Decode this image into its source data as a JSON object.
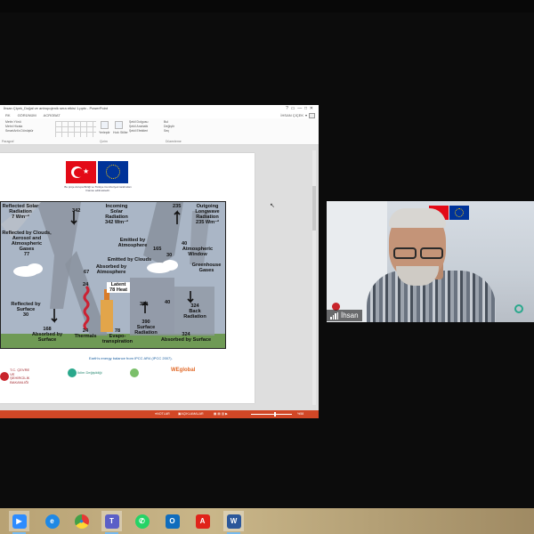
{
  "powerpoint": {
    "doc_title": "İhsan Çiçek_Doğal ve antropojenik sera etkisi 1.pptx - PowerPoint",
    "tabs": [
      "RK",
      "GÖRÜNÜM",
      "ACROBAT"
    ],
    "user_name": "İhsan Çiçek",
    "ribbon": {
      "slide_items": [
        "Metin Yönü",
        "Metni Hizala",
        "SmartArt'a Dönüştür"
      ],
      "arrange_label": "Yerleştir",
      "quick_styles_label": "Hızlı Stiller",
      "shape_fill": "Şekil Dolgusu",
      "shape_outline": "Şekil Anahattı",
      "shape_effects": "Şekil Efektleri",
      "find": "Bul",
      "replace": "Değiştir",
      "select": "Seç",
      "group_paragraph": "Paragraf",
      "group_drawing": "Çizim",
      "group_editing": "Düzenleme"
    },
    "slide": {
      "eu_note": "Bu proje Avrupa Birliği ve Türkiye Cumhuriyeti tarafından finanse edilmektedir.",
      "diagram_labels": {
        "reflected_solar": "Reflected Solar\nRadiation\n7 Wm⁻²",
        "incoming_342": "342",
        "incoming_solar": "Incoming\nSolar\nRadiation\n342 Wm⁻²",
        "outgoing_235": "235",
        "outgoing_longwave": "Outgoing\nLongwave\nRadiation\n235 Wm⁻²",
        "reflected_clouds": "Reflected by Clouds,\nAerosol and\nAtmospheric\nGases\n77",
        "emitted_atmosphere": "Emitted by\nAtmosphere",
        "val_165": "165",
        "val_30": "30",
        "val_40_window": "40",
        "atmospheric_window": "Atmospheric\nWindow",
        "emitted_clouds": "Emitted by Clouds",
        "greenhouse_gases": "Greenhouse\nGases",
        "val_67": "67",
        "absorbed_atmosphere": "Absorbed by\nAtmosphere",
        "latent_heat": "Latent\n78 Heat",
        "val_24": "24",
        "val_350": "350",
        "val_40": "40",
        "val_324_back": "324\nBack\nRadiation",
        "reflected_surface": "Reflected by\nSurface\n30",
        "absorbed_surface_168": "168\nAbsorbed by\nSurface",
        "thermals": "24\nThermals",
        "evapotranspiration": "78\nEvapo-\ntranspiration",
        "surface_radiation": "390\nSurface\nRadiation",
        "absorbed_surface_324": "324\nAbsorbed by Surface"
      },
      "caption": "Earth's energy balance from IPCC AR4 (IPCC 2007).",
      "partners": [
        "T.C. ÇEVRE VE ŞEHİRCİLİK BAKANLIĞI",
        "İklim Değişikliği",
        "WEglobal"
      ]
    },
    "statusbar": {
      "notes": "NOTLAR",
      "comments": "AÇIKLAMALAR",
      "zoom": "%58"
    }
  },
  "video": {
    "participant_name": "İhsan"
  },
  "taskbar": {
    "apps": [
      {
        "name": "zoom",
        "glyph": "▶",
        "color": "#2d8cff"
      },
      {
        "name": "internet-explorer",
        "glyph": "e",
        "color": "#1e88e5"
      },
      {
        "name": "chrome",
        "glyph": "●",
        "color": "#e53935"
      },
      {
        "name": "teams",
        "glyph": "T",
        "color": "#5b5fc7"
      },
      {
        "name": "whatsapp",
        "glyph": "✆",
        "color": "#25d366"
      },
      {
        "name": "outlook",
        "glyph": "O",
        "color": "#0f6cbd"
      },
      {
        "name": "acrobat",
        "glyph": "A",
        "color": "#e0231a"
      },
      {
        "name": "word",
        "glyph": "W",
        "color": "#2b579a"
      }
    ]
  }
}
